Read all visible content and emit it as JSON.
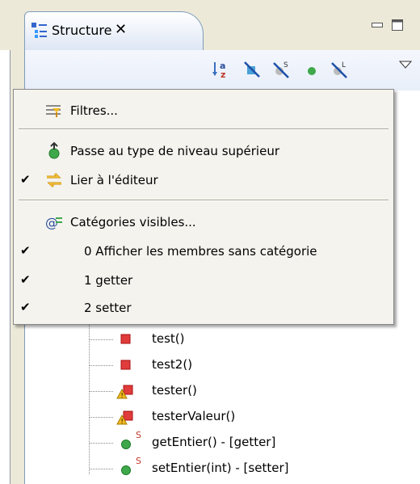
{
  "view": {
    "title": "Structure",
    "close_symbol": "✕",
    "toolbar": {
      "buttons": [
        {
          "name": "sort-icon",
          "tooltip_icon": "sort-a-z"
        },
        {
          "name": "hide-fields-icon",
          "tooltip_icon": "hide-fields"
        },
        {
          "name": "hide-static-icon",
          "tooltip_icon": "hide-static-members"
        },
        {
          "name": "public-members-icon",
          "tooltip_icon": "public-member-dot"
        },
        {
          "name": "hide-local-types-icon",
          "tooltip_icon": "hide-local-types"
        }
      ]
    }
  },
  "menu": {
    "items": [
      {
        "label": "Filtres...",
        "checked": false,
        "icon": "filter-icon"
      },
      {
        "label": "Passe au type de niveau supérieur",
        "checked": false,
        "icon": "go-to-top-level-type-icon"
      },
      {
        "label": "Lier à l'éditeur",
        "checked": true,
        "icon": "link-with-editor-icon"
      },
      {
        "label": "Catégories visibles...",
        "checked": false,
        "icon": "categories-icon"
      },
      {
        "label": "0 Afficher les membres sans catégorie",
        "checked": true,
        "icon": ""
      },
      {
        "label": "1 getter",
        "checked": true,
        "icon": ""
      },
      {
        "label": "2 setter",
        "checked": true,
        "icon": ""
      }
    ],
    "check_mark": "✔"
  },
  "outline": {
    "items": [
      {
        "label": "test()",
        "icon": "private-method-icon"
      },
      {
        "label": "test2()",
        "icon": "private-method-icon"
      },
      {
        "label": "tester()",
        "icon": "private-method-warning-icon"
      },
      {
        "label": "testerValeur()",
        "icon": "private-method-warning-icon"
      },
      {
        "label": "getEntier() - [getter]",
        "icon": "public-static-method-icon"
      },
      {
        "label": "setEntier(int) - [setter]",
        "icon": "public-static-method-icon"
      }
    ],
    "static_marker": "S"
  },
  "colors": {
    "private_method": "#e03c3c",
    "public_method": "#3ea84a",
    "warning": "#f2b820",
    "tab_border": "#7f9db9"
  }
}
